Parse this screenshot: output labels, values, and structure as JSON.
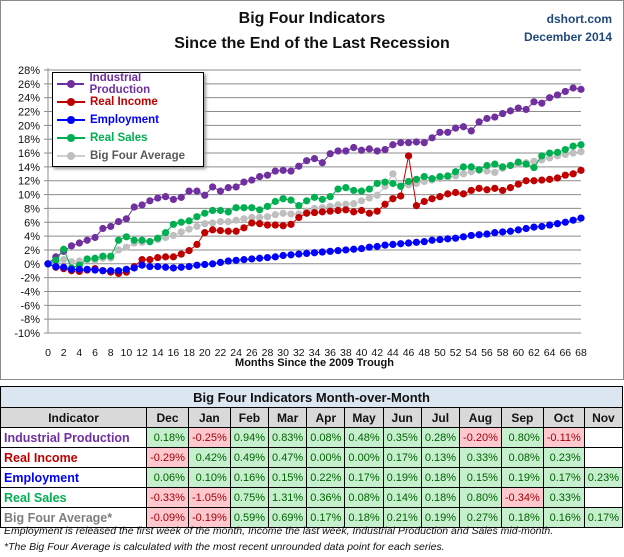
{
  "header": {
    "title_line1": "Big Four Indicators",
    "title_line2": "Since the End of the Last Recession",
    "source": "dshort.com",
    "date": "December 2014"
  },
  "chart_data": {
    "type": "line",
    "title": "Big Four Indicators Since the End of the Last Recession",
    "xlabel": "Months Since the 2009 Trough",
    "ylabel": "",
    "x_ticks": [
      0,
      2,
      4,
      6,
      8,
      10,
      12,
      14,
      16,
      18,
      20,
      22,
      24,
      26,
      28,
      30,
      32,
      34,
      36,
      38,
      40,
      42,
      44,
      46,
      48,
      50,
      52,
      54,
      56,
      58,
      60,
      62,
      64,
      66,
      68
    ],
    "xlim": [
      0,
      68
    ],
    "ylim": [
      -10,
      28
    ],
    "y_ticks": [
      "-10%",
      "-8%",
      "-6%",
      "-4%",
      "-2%",
      "0%",
      "2%",
      "4%",
      "6%",
      "8%",
      "10%",
      "12%",
      "14%",
      "16%",
      "18%",
      "20%",
      "22%",
      "24%",
      "26%",
      "28%"
    ],
    "y_tick_values": [
      -10,
      -8,
      -6,
      -4,
      -2,
      0,
      2,
      4,
      6,
      8,
      10,
      12,
      14,
      16,
      18,
      20,
      22,
      24,
      26,
      28
    ],
    "grid": true,
    "legend_position": "top-left",
    "series": [
      {
        "name": "Industrial Production",
        "color": "#7030a0",
        "values": [
          0,
          1.0,
          1.8,
          2.6,
          3.0,
          3.4,
          3.8,
          5.1,
          5.4,
          6.1,
          6.5,
          8.2,
          8.5,
          9.1,
          9.5,
          9.7,
          9.3,
          9.6,
          10.5,
          10.5,
          9.9,
          11.1,
          10.5,
          11.0,
          11.1,
          11.8,
          12.1,
          12.6,
          12.8,
          13.4,
          13.5,
          13.4,
          14.1,
          14.9,
          15.2,
          14.6,
          15.9,
          16.3,
          16.3,
          16.8,
          16.4,
          16.6,
          16.3,
          16.5,
          17.2,
          17.5,
          17.5,
          17.6,
          17.5,
          18.2,
          19.0,
          19.0,
          19.6,
          19.8,
          19.2,
          20.5,
          21.0,
          21.2,
          21.7,
          22.1,
          22.5,
          22.3,
          23.4,
          23.2,
          24.0,
          24.4,
          24.9,
          25.4,
          25.2
        ]
      },
      {
        "name": "Real Income",
        "color": "#c00000",
        "values": [
          0,
          -0.5,
          -0.7,
          -1.0,
          -1.1,
          -0.9,
          -0.7,
          -1.0,
          -1.2,
          -1.4,
          -1.2,
          -0.4,
          0.6,
          0.6,
          0.9,
          1.0,
          1.0,
          1.4,
          1.9,
          2.8,
          4.5,
          4.9,
          4.8,
          4.7,
          4.7,
          5.2,
          5.9,
          5.8,
          5.6,
          5.6,
          5.5,
          5.7,
          6.7,
          7.3,
          7.4,
          7.5,
          7.6,
          7.7,
          7.8,
          7.5,
          7.7,
          7.3,
          7.6,
          8.6,
          9.4,
          9.8,
          15.6,
          8.4,
          9.0,
          9.4,
          9.7,
          10.1,
          10.3,
          10.1,
          10.6,
          10.9,
          10.7,
          10.9,
          10.6,
          11.0,
          11.5,
          12.0,
          12.0,
          12.1,
          12.2,
          12.4,
          12.8,
          13.0,
          13.5
        ]
      },
      {
        "name": "Employment",
        "color": "#0000ff",
        "values": [
          0,
          -0.4,
          -0.5,
          -0.8,
          -0.8,
          -0.8,
          -0.9,
          -1.0,
          -1.0,
          -1.0,
          -0.8,
          -0.6,
          -0.2,
          -0.4,
          -0.4,
          -0.5,
          -0.6,
          -0.5,
          -0.4,
          -0.2,
          -0.1,
          0.0,
          0.2,
          0.4,
          0.5,
          0.6,
          0.7,
          0.8,
          0.9,
          1.0,
          1.2,
          1.3,
          1.4,
          1.5,
          1.6,
          1.7,
          1.8,
          1.9,
          2.0,
          2.1,
          2.2,
          2.4,
          2.5,
          2.7,
          2.8,
          2.9,
          3.0,
          3.1,
          3.2,
          3.4,
          3.5,
          3.6,
          3.7,
          3.9,
          4.1,
          4.2,
          4.3,
          4.5,
          4.6,
          4.7,
          4.9,
          5.1,
          5.3,
          5.4,
          5.6,
          5.8,
          6.0,
          6.3,
          6.6
        ]
      },
      {
        "name": "Real Sales",
        "color": "#00b050",
        "values": [
          0,
          0.5,
          2.1,
          -0.6,
          -0.2,
          0.7,
          0.8,
          1.1,
          1.1,
          3.4,
          3.9,
          3.4,
          3.4,
          3.2,
          3.7,
          4.5,
          5.7,
          6.0,
          6.2,
          6.8,
          7.3,
          7.7,
          7.7,
          7.5,
          8.1,
          8.1,
          8.1,
          7.8,
          8.3,
          9.0,
          9.4,
          9.2,
          8.4,
          9.1,
          9.6,
          9.3,
          9.7,
          10.8,
          11.0,
          10.6,
          10.5,
          10.8,
          11.6,
          11.8,
          11.6,
          11.2,
          11.9,
          12.2,
          12.6,
          12.3,
          12.6,
          12.7,
          13.3,
          14.0,
          14.0,
          13.6,
          14.2,
          14.4,
          14.0,
          14.2,
          14.7,
          14.4,
          13.9,
          15.6,
          16.0,
          16.1,
          16.5,
          17.0,
          17.2
        ]
      },
      {
        "name": "Big Four Average",
        "color": "#bfbfbf",
        "values": [
          0,
          0.3,
          0.6,
          0.3,
          0.4,
          0.6,
          0.5,
          0.8,
          0.8,
          2.0,
          2.4,
          3.0,
          3.1,
          3.2,
          3.5,
          3.8,
          4.1,
          4.6,
          5.0,
          5.4,
          5.8,
          5.9,
          6.1,
          6.1,
          6.3,
          6.5,
          6.7,
          6.7,
          6.8,
          7.1,
          7.3,
          7.2,
          7.2,
          7.6,
          8.0,
          8.1,
          8.3,
          8.5,
          8.6,
          8.7,
          9.1,
          9.5,
          9.9,
          11.2,
          13.0,
          11.2,
          11.4,
          11.6,
          11.9,
          12.1,
          12.3,
          12.5,
          12.7,
          13.0,
          13.3,
          13.5,
          13.4,
          13.2,
          13.8,
          14.2,
          14.4,
          14.6,
          14.8,
          15.0,
          15.3,
          15.6,
          15.8,
          16.0,
          16.2
        ]
      }
    ]
  },
  "table": {
    "title": "Big Four Indicators Month-over-Month",
    "columns": [
      "Indicator",
      "Dec",
      "Jan",
      "Feb",
      "Mar",
      "Apr",
      "May",
      "Jun",
      "Jul",
      "Aug",
      "Sep",
      "Oct",
      "Nov"
    ],
    "rows": [
      {
        "label": "Industrial Production",
        "color": "#7030a0",
        "values": [
          "0.18%",
          "-0.25%",
          "0.94%",
          "0.83%",
          "0.08%",
          "0.48%",
          "0.35%",
          "0.28%",
          "-0.20%",
          "0.80%",
          "-0.11%",
          ""
        ]
      },
      {
        "label": "Real Income",
        "color": "#c00000",
        "values": [
          "-0.29%",
          "0.42%",
          "0.49%",
          "0.47%",
          "0.00%",
          "0.00%",
          "0.17%",
          "0.13%",
          "0.33%",
          "0.08%",
          "0.23%",
          ""
        ]
      },
      {
        "label": "Employment",
        "color": "#0000ff",
        "values": [
          "0.06%",
          "0.10%",
          "0.16%",
          "0.15%",
          "0.22%",
          "0.17%",
          "0.19%",
          "0.18%",
          "0.15%",
          "0.19%",
          "0.17%",
          "0.23%"
        ]
      },
      {
        "label": "Real Sales",
        "color": "#00b050",
        "values": [
          "-0.33%",
          "-1.05%",
          "0.75%",
          "1.31%",
          "0.36%",
          "0.08%",
          "0.14%",
          "0.18%",
          "0.80%",
          "-0.34%",
          "0.33%",
          ""
        ]
      },
      {
        "label": "Big Four Average*",
        "color": "#7f7f7f",
        "values": [
          "-0.09%",
          "-0.19%",
          "0.59%",
          "0.69%",
          "0.17%",
          "0.18%",
          "0.21%",
          "0.19%",
          "0.27%",
          "0.18%",
          "0.16%",
          "0.17%"
        ]
      }
    ]
  },
  "notes": {
    "line1": "Employment is released the first week of the month, Income the last week, Industrial Production and Sales mid-month.",
    "line2": "*The Big Four Average is calculated with the most recent  unrounded data point for each series."
  }
}
